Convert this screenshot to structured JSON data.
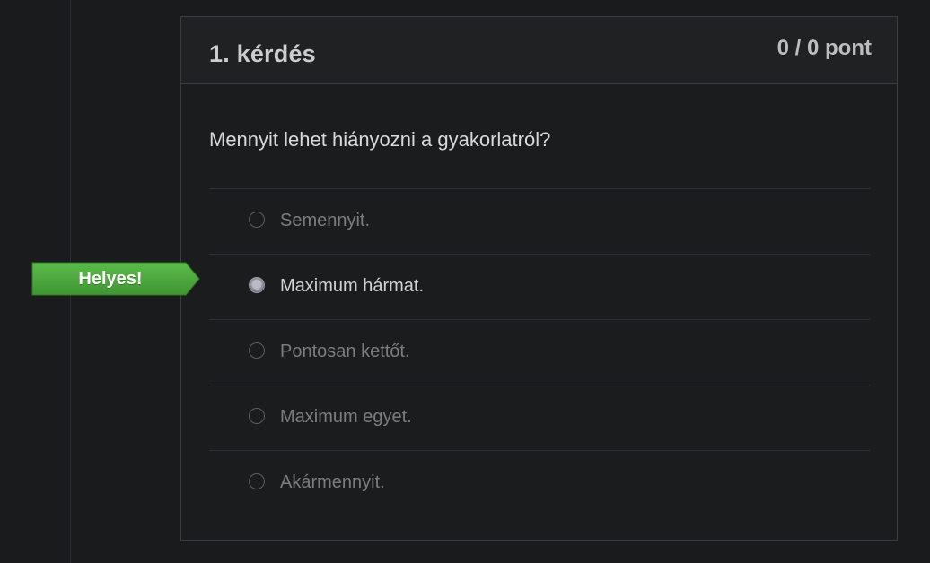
{
  "question": {
    "title": "1. kérdés",
    "points": "0 / 0 pont",
    "text": "Mennyit lehet hiányozni a gyakorlatról?"
  },
  "answers": [
    {
      "label": "Semennyit.",
      "selected": false
    },
    {
      "label": "Maximum hármat.",
      "selected": true
    },
    {
      "label": "Pontosan kettőt.",
      "selected": false
    },
    {
      "label": "Maximum egyet.",
      "selected": false
    },
    {
      "label": "Akármennyit.",
      "selected": false
    }
  ],
  "feedback": {
    "label": "Helyes!",
    "color": "#4aa43c"
  },
  "colors": {
    "background": "#1a1b1d",
    "card_header": "#202123",
    "border": "#3d3e41",
    "correct": "#4aa43c"
  }
}
